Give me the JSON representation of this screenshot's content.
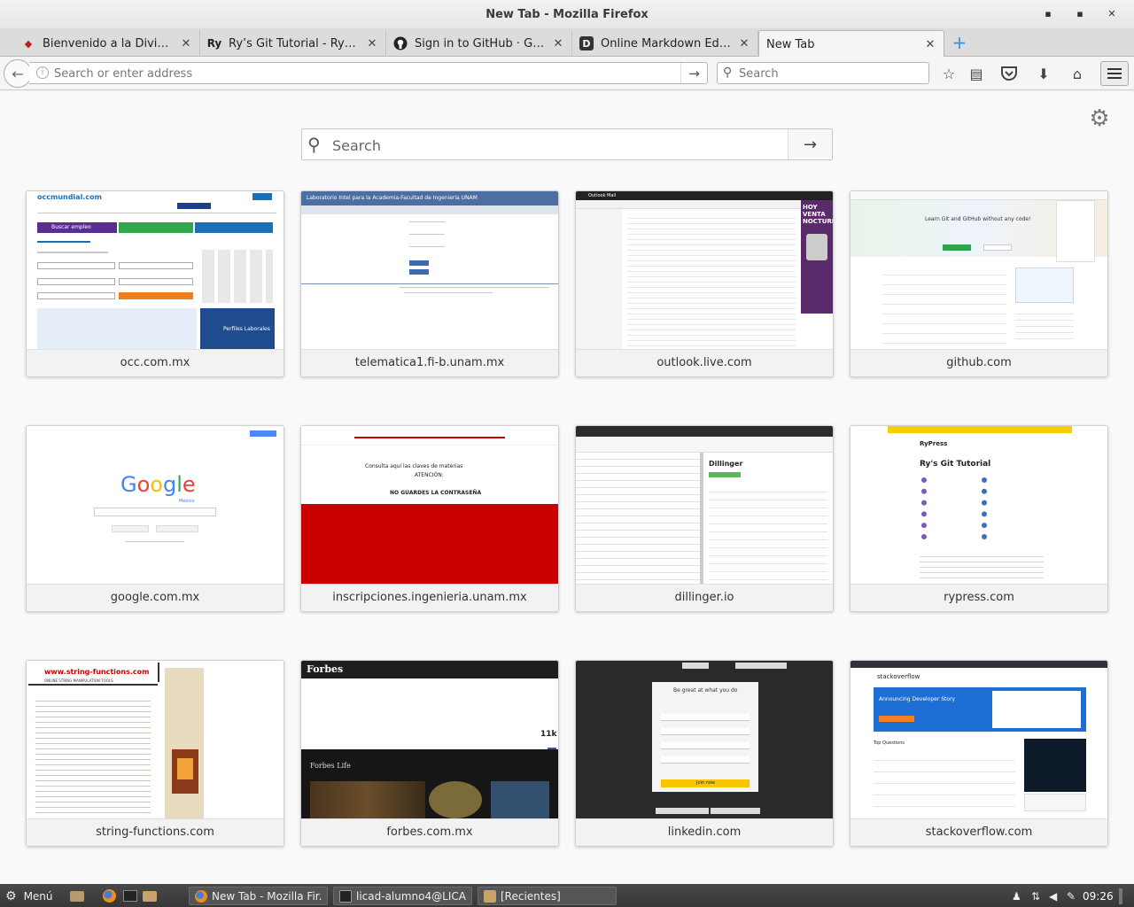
{
  "window": {
    "title": "New Tab - Mozilla Firefox"
  },
  "tabs": [
    {
      "label": "Bienvenido a la Divisió...",
      "favicon": "unam-icon"
    },
    {
      "label": "Ry’s Git Tutorial - RyPress",
      "favicon": "Ry"
    },
    {
      "label": "Sign in to GitHub · Git...",
      "favicon": "github-icon"
    },
    {
      "label": "Online Markdown Edito...",
      "favicon": "D"
    },
    {
      "label": "New Tab",
      "favicon": ""
    }
  ],
  "toolbar": {
    "url_placeholder": "Search or enter address",
    "search_placeholder": "Search"
  },
  "newtab": {
    "search_placeholder": "Search",
    "tiles": [
      {
        "label": "occ.com.mx"
      },
      {
        "label": "telematica1.fi-b.unam.mx"
      },
      {
        "label": "outlook.live.com"
      },
      {
        "label": "github.com"
      },
      {
        "label": "google.com.mx"
      },
      {
        "label": "inscripciones.ingenieria.unam.mx"
      },
      {
        "label": "dillinger.io"
      },
      {
        "label": "rypress.com"
      },
      {
        "label": "string-functions.com"
      },
      {
        "label": "forbes.com.mx"
      },
      {
        "label": "linkedin.com"
      },
      {
        "label": "stackoverflow.com"
      }
    ]
  },
  "thumbs": {
    "occ": {
      "logo": "occmundial.com",
      "cta": "Buscar empleo",
      "banner": "Perfiles Laborales"
    },
    "telematica": {
      "header": "Laboratorio Intel para la Academia-Facultad de Ingeniería UNAM"
    },
    "outlook": {
      "header": "Outlook Mail",
      "ad": "HOY VENTA NOCTURNA"
    },
    "github": {
      "headline": "Learn Git and GitHub without any code!"
    },
    "google": {
      "logo": "Google",
      "sub": "México"
    },
    "inscripciones": {
      "line1": "Consulta aquí las claves de materias",
      "line2": "ATENCIÓN:",
      "line3": "NO GUARDES LA CONTRASEÑA"
    },
    "dillinger": {
      "title": "Dillinger"
    },
    "rypress": {
      "brand": "RyPress",
      "title": "Ry's Git Tutorial"
    },
    "stringfn": {
      "logo": "www.string-functions.com",
      "sub": "ONLINE STRING MANIPULATION TOOLS"
    },
    "forbes": {
      "logo": "Forbes",
      "section": "Forbes Life",
      "count": "11k"
    },
    "linkedin": {
      "headline": "Be great at what you do",
      "cta": "Join now"
    },
    "stackoverflow": {
      "logo": "stackoverflow",
      "banner": "Announcing Developer Story",
      "section": "Top Questions"
    }
  },
  "taskbar": {
    "menu": "Menú",
    "windows": [
      {
        "label": "New Tab - Mozilla Fir..."
      },
      {
        "label": "licad-alumno4@LICA..."
      },
      {
        "label": "[Recientes]"
      }
    ],
    "clock": "09:26"
  },
  "colors": {
    "accent": "#3d8fd6",
    "taskbar": "#3c3c3c"
  }
}
